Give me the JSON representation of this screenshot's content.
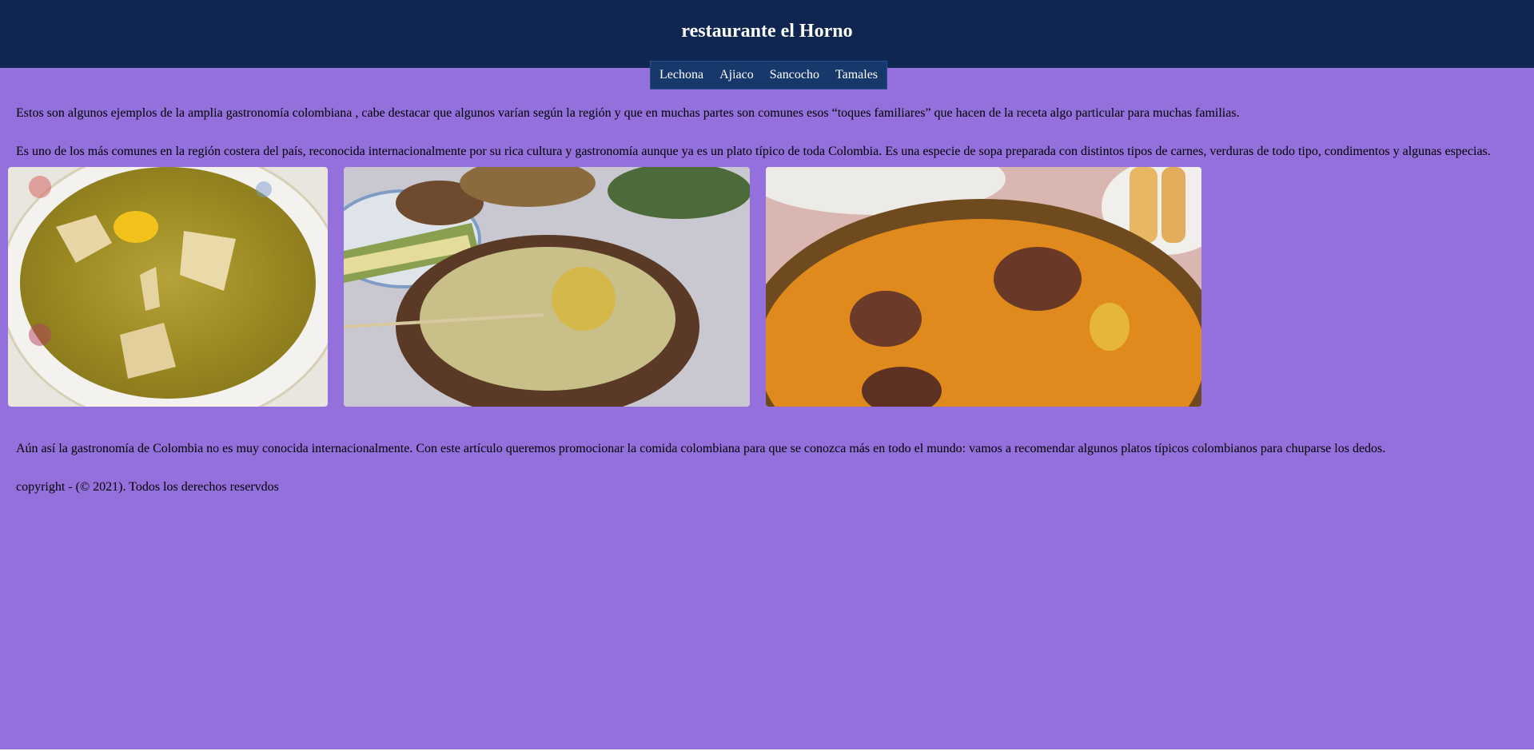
{
  "header": {
    "title": "restaurante el Horno"
  },
  "nav": {
    "items": [
      {
        "label": "Lechona"
      },
      {
        "label": "Ajiaco"
      },
      {
        "label": "Sancocho"
      },
      {
        "label": "Tamales"
      }
    ]
  },
  "main": {
    "intro": "Estos son algunos ejemplos de la amplia gastronomía colombiana , cabe destacar que algunos varían según la región y que en muchas partes son comunes esos “toques familiares” que hacen de la receta algo particular para muchas familias.",
    "description": "Es uno de los más comunes en la región costera del país, reconocida internacionalmente por su rica cultura y gastronomía aunque ya es un plato típico de toda Colombia. Es una especie de sopa preparada con distintos tipos de carnes, verduras de todo tipo, condimentos y algunas especias.",
    "gallery": [
      {
        "name": "sancocho-photo"
      },
      {
        "name": "ajiaco-photo"
      },
      {
        "name": "arroz-photo"
      }
    ],
    "promo": "Aún así la gastronomía de Colombia no es muy conocida internacionalmente. Con este artículo queremos promocionar la comida colombiana para que se conozca más en todo el mundo: vamos a recomendar algunos platos típicos colombianos para chuparse los dedos."
  },
  "footer": {
    "copyright": "copyright - (© 2021). Todos los derechos reservdos"
  },
  "colors": {
    "page_background": "#9370db",
    "header_background": "#0f2650",
    "nav_background": "#17386b"
  }
}
